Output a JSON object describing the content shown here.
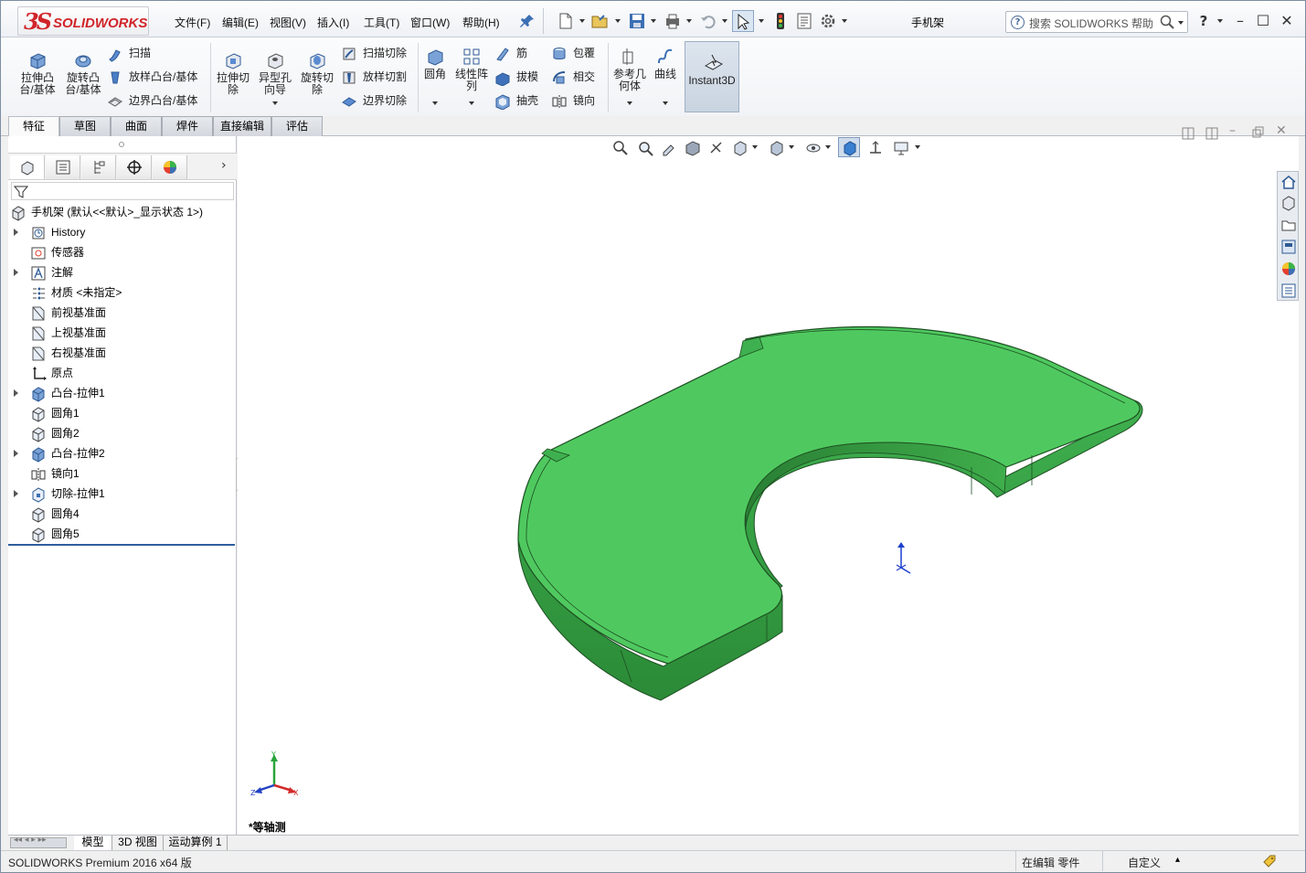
{
  "app": {
    "brand_ds": "3S",
    "brand_name": "SOLIDWORKS",
    "document_title": "手机架"
  },
  "menu": [
    "文件(F)",
    "编辑(E)",
    "视图(V)",
    "插入(I)",
    "工具(T)",
    "窗口(W)",
    "帮助(H)"
  ],
  "search": {
    "placeholder": "搜索 SOLIDWORKS 帮助",
    "help_label": "?"
  },
  "ribbon": {
    "extrude_boss": "拉伸凸\n台/基体",
    "revolve_boss": "旋转凸\n台/基体",
    "sweep": "扫描",
    "loft_boss": "放样凸台/基体",
    "boundary_boss": "边界凸台/基体",
    "extrude_cut": "拉伸切\n除",
    "hole_wizard": "异型孔\n向导",
    "revolve_cut": "旋转切\n除",
    "swept_cut": "扫描切除",
    "lofted_cut": "放样切割",
    "boundary_cut": "边界切除",
    "fillet": "圆角",
    "linear_pattern": "线性阵\n列",
    "rib": "筋",
    "draft": "拔模",
    "shell": "抽壳",
    "wrap": "包覆",
    "intersect": "相交",
    "mirror": "镜向",
    "ref_geometry": "参考几\n何体",
    "curves": "曲线",
    "instant3d": "Instant3D"
  },
  "tabs": [
    "特征",
    "草图",
    "曲面",
    "焊件",
    "直接编辑",
    "评估"
  ],
  "tree": {
    "root": "手机架 (默认<<默认>_显示状态 1>)",
    "items": [
      {
        "label": "History",
        "expandable": true,
        "icon": "history-icon"
      },
      {
        "label": "传感器",
        "expandable": false,
        "icon": "sensor-icon"
      },
      {
        "label": "注解",
        "expandable": true,
        "icon": "annotation-icon"
      },
      {
        "label": "材质 <未指定>",
        "expandable": false,
        "icon": "material-icon"
      },
      {
        "label": "前视基准面",
        "expandable": false,
        "icon": "plane-icon"
      },
      {
        "label": "上视基准面",
        "expandable": false,
        "icon": "plane-icon"
      },
      {
        "label": "右视基准面",
        "expandable": false,
        "icon": "plane-icon"
      },
      {
        "label": "原点",
        "expandable": false,
        "icon": "origin-icon"
      },
      {
        "label": "凸台-拉伸1",
        "expandable": true,
        "icon": "extrude-icon"
      },
      {
        "label": "圆角1",
        "expandable": false,
        "icon": "fillet-icon"
      },
      {
        "label": "圆角2",
        "expandable": false,
        "icon": "fillet-icon"
      },
      {
        "label": "凸台-拉伸2",
        "expandable": true,
        "icon": "extrude-icon"
      },
      {
        "label": "镜向1",
        "expandable": false,
        "icon": "mirror-icon"
      },
      {
        "label": "切除-拉伸1",
        "expandable": true,
        "icon": "cut-extrude-icon"
      },
      {
        "label": "圆角4",
        "expandable": false,
        "icon": "fillet-icon"
      },
      {
        "label": "圆角5",
        "expandable": false,
        "icon": "fillet-icon"
      }
    ]
  },
  "bottom_tabs": [
    "模型",
    "3D 视图",
    "运动算例 1"
  ],
  "viewport": {
    "view_label": "*等轴测",
    "triad_x": "X",
    "triad_y": "Y",
    "triad_z": "Z"
  },
  "status": {
    "product": "SOLIDWORKS Premium 2016 x64 版",
    "editing": "在编辑 零件",
    "units": "自定义"
  },
  "colors": {
    "part_green": "#4fc95f",
    "part_green_dark": "#2f8f3a",
    "brand_red": "#d1242a"
  }
}
